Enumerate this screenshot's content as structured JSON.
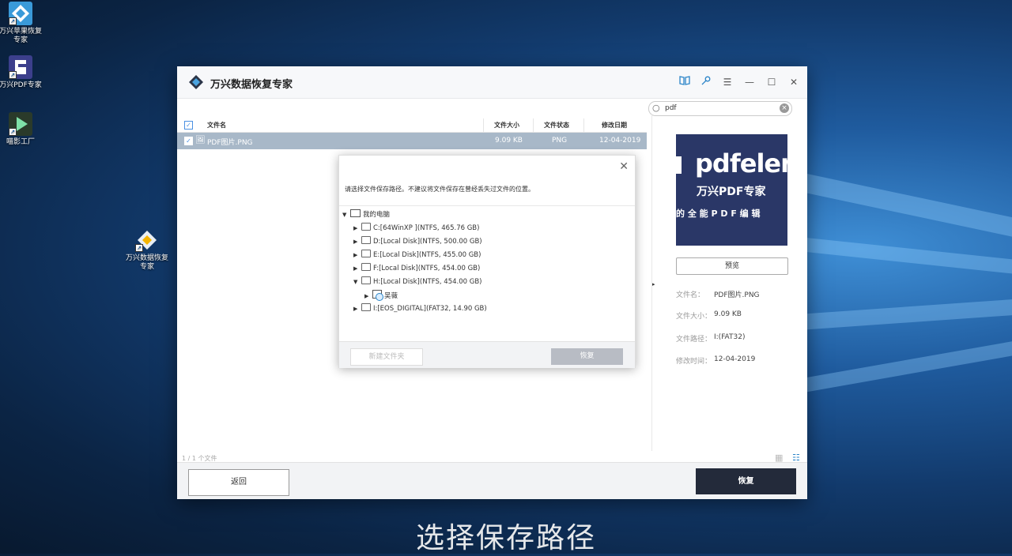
{
  "desktop": {
    "icons": [
      {
        "label": "万兴苹果恢复专家"
      },
      {
        "label": "万兴PDF专家"
      },
      {
        "label": "喵影工厂"
      },
      {
        "label": "万兴数据恢复专家"
      }
    ]
  },
  "app": {
    "title": "万兴数据恢复专家",
    "titlebar_buttons": [
      "book-icon",
      "key-icon",
      "menu-icon",
      "minimize-icon",
      "maximize-icon",
      "close-icon"
    ],
    "search": {
      "value": "pdf",
      "placeholder": ""
    },
    "table": {
      "headers": {
        "name": "文件名",
        "size": "文件大小",
        "status": "文件状态",
        "date": "修改日期"
      },
      "rows": [
        {
          "name": "PDF图片.PNG",
          "size": "9.09  KB",
          "status": "PNG",
          "date": "12-04-2019",
          "checked": true
        }
      ]
    },
    "preview": {
      "image_text1": "pdfelen",
      "image_text2": "万兴PDF专家",
      "image_text3": "的 全 能 P D F 编 辑",
      "button": "预览",
      "info": {
        "name_label": "文件名：",
        "name_value": "PDF图片.PNG",
        "size_label": "文件大小：",
        "size_value": "9.09  KB",
        "path_label": "文件路径：",
        "path_value": "I:(FAT32)",
        "date_label": "修改时间：",
        "date_value": "12-04-2019"
      }
    },
    "status_text": "1 / 1 个文件",
    "footer": {
      "back": "返回",
      "recover": "恢复"
    }
  },
  "dialog": {
    "message": "请选择文件保存路径。不建议将文件保存在曾经丢失过文件的位置。",
    "root": "我的电脑",
    "drives": [
      {
        "label": "C:[64WinXP ](NTFS, 465.76  GB)"
      },
      {
        "label": "D:[Local Disk](NTFS, 500.00  GB)"
      },
      {
        "label": "E:[Local Disk](NTFS, 455.00  GB)"
      },
      {
        "label": "F:[Local Disk](NTFS, 454.00  GB)"
      },
      {
        "label": "H:[Local Disk](NTFS, 454.00  GB)"
      },
      {
        "label": "吴薇"
      },
      {
        "label": "I:[EOS_DIGITAL](FAT32, 14.90  GB)"
      }
    ],
    "new_folder": "新建文件夹",
    "recover": "恢复"
  },
  "subtitle": "选择保存路径",
  "colors": {
    "accent_dark": "#232a3a",
    "selected_row": "#a8b8c8",
    "preview_bg": "#2a3767"
  }
}
